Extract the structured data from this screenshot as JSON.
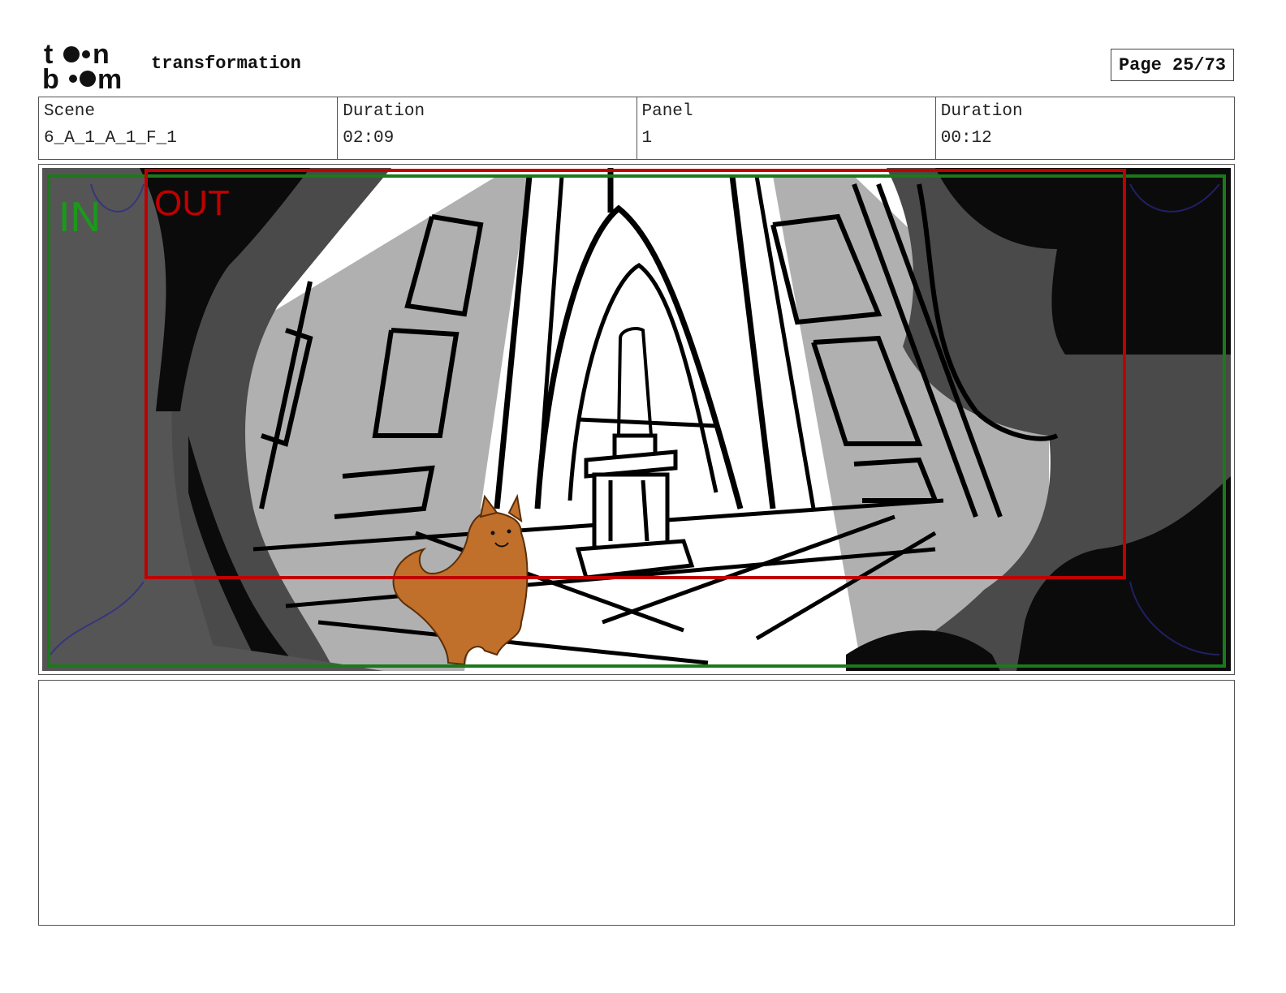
{
  "header": {
    "logo_text_top": "toon",
    "logo_text_bottom": "boom",
    "title": "transformation",
    "page_label": "Page 25/73"
  },
  "info": [
    {
      "label": "Scene",
      "value": "6_A_1_A_1_F_1"
    },
    {
      "label": "Duration",
      "value": "02:09"
    },
    {
      "label": "Panel",
      "value": "1"
    },
    {
      "label": "Duration",
      "value": "00:12"
    }
  ],
  "panel": {
    "in_label": "IN",
    "out_label": "OUT",
    "colors": {
      "in_frame": "#1a7a1a",
      "out_frame": "#c00000",
      "cat": "#c0702a"
    }
  },
  "notes": {
    "text": ""
  }
}
